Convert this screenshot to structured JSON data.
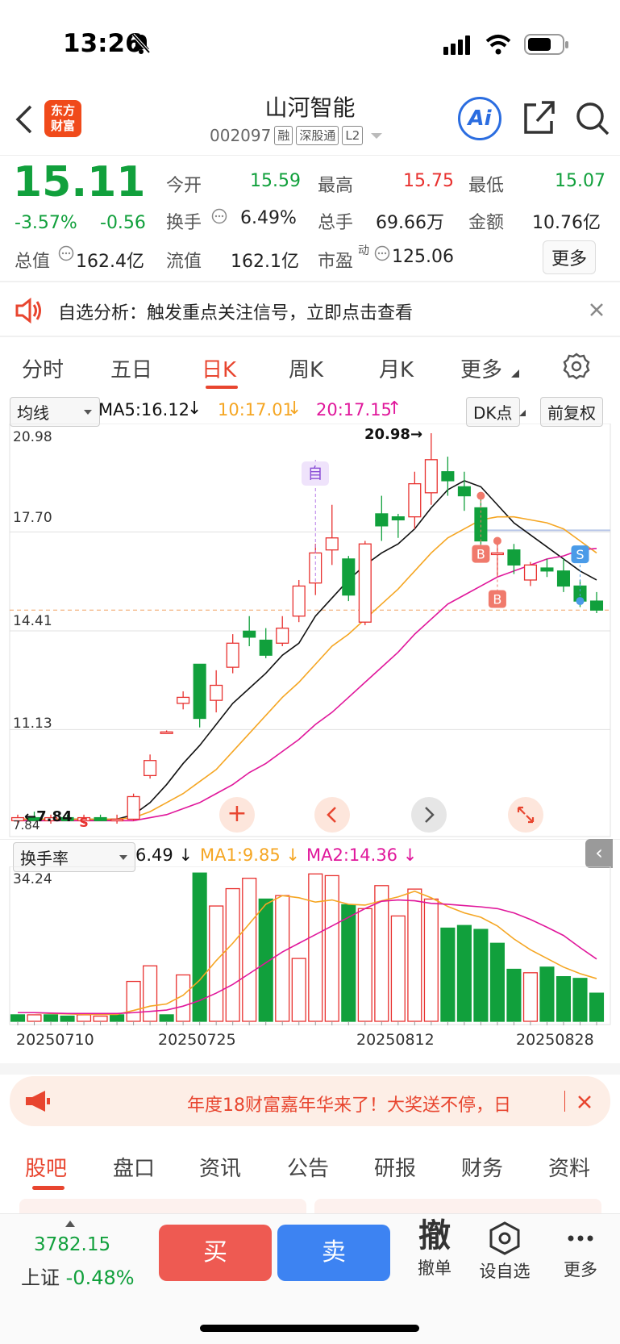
{
  "status_bar": {
    "time": "13:26"
  },
  "header": {
    "logo_text": "东方\n财富",
    "title": "山河智能",
    "code": "002097",
    "tags": [
      "融",
      "深股通",
      "L2"
    ],
    "ai_label": "Ai"
  },
  "quote": {
    "price": "15.11",
    "change_pct": "-3.57%",
    "change": "-0.56",
    "open_label": "今开",
    "open": "15.59",
    "high_label": "最高",
    "high": "15.75",
    "low_label": "最低",
    "low": "15.07",
    "turnover_label": "换手",
    "turnover": "6.49%",
    "volume_label": "总手",
    "volume": "69.66万",
    "amount_label": "金额",
    "amount": "10.76亿",
    "mcap_label": "总值",
    "mcap": "162.4亿",
    "float_label": "流值",
    "float": "162.1亿",
    "pe_label": "市盈",
    "pe_sup": "动",
    "pe": "125.06",
    "more": "更多"
  },
  "notice": {
    "text": "自选分析：触发重点关注信号，立即点击查看"
  },
  "chart_tabs": [
    "分时",
    "五日",
    "日K",
    "周K",
    "月K",
    "更多"
  ],
  "active_tab": "日K",
  "ma_bar": {
    "select": "均线",
    "ma5": "MA5:16.12",
    "ma10": "10:17.01",
    "ma20": "20:17.15",
    "dk": "DK点",
    "fq": "前复权"
  },
  "price_axis": [
    "20.98",
    "17.70",
    "14.41",
    "11.13",
    "7.84"
  ],
  "price_annotations": {
    "high": "20.98",
    "low": "7.84",
    "self_tag": "自"
  },
  "turnover_bar": {
    "select": "换手率",
    "value": "6.49",
    "ma1": "MA1:9.85",
    "ma2": "MA2:14.36",
    "axis_top": "34.24"
  },
  "dates": [
    "20250710",
    "20250725",
    "20250812",
    "20250828"
  ],
  "banner": {
    "text": "年度18财富嘉年华来了！大奖送不停，日"
  },
  "bottom_tabs": [
    "股吧",
    "盘口",
    "资讯",
    "公告",
    "研报",
    "财务",
    "资料"
  ],
  "active_bottom_tab": "股吧",
  "footer": {
    "index_value": "3782.15",
    "index_name": "上证",
    "index_change": "-0.48%",
    "buy": "买",
    "sell": "卖",
    "cancel_big": "撤",
    "cancel": "撤单",
    "watch": "设自选",
    "more": "更多"
  },
  "colors": {
    "up": "#e8312f",
    "down": "#11a03c",
    "ma5": "#111111",
    "ma10": "#f5a623",
    "ma20": "#e0179b",
    "accent": "#e8452f",
    "buy": "#ee5a52",
    "sell": "#3d83f2"
  },
  "chart_data": {
    "type": "candlestick",
    "y_range": [
      7.84,
      20.98
    ],
    "candles": [
      {
        "o": 8.1,
        "h": 8.3,
        "l": 8.0,
        "c": 8.2
      },
      {
        "o": 8.2,
        "h": 8.4,
        "l": 8.1,
        "c": 8.1
      },
      {
        "o": 8.1,
        "h": 8.3,
        "l": 8.0,
        "c": 8.2
      },
      {
        "o": 8.2,
        "h": 8.3,
        "l": 8.1,
        "c": 8.1
      },
      {
        "o": 8.1,
        "h": 8.3,
        "l": 8.0,
        "c": 8.2
      },
      {
        "o": 8.2,
        "h": 8.3,
        "l": 8.1,
        "c": 8.1
      },
      {
        "o": 8.1,
        "h": 8.3,
        "l": 8.0,
        "c": 8.15
      },
      {
        "o": 8.15,
        "h": 9.0,
        "l": 8.1,
        "c": 8.9
      },
      {
        "o": 9.6,
        "h": 10.3,
        "l": 9.5,
        "c": 10.1
      },
      {
        "o": 11.0,
        "h": 11.1,
        "l": 11.0,
        "c": 11.05
      },
      {
        "o": 12.0,
        "h": 12.4,
        "l": 11.8,
        "c": 12.2
      },
      {
        "o": 13.3,
        "h": 13.3,
        "l": 11.2,
        "c": 11.5
      },
      {
        "o": 12.1,
        "h": 13.1,
        "l": 11.7,
        "c": 12.6
      },
      {
        "o": 13.2,
        "h": 14.3,
        "l": 13.0,
        "c": 14.0
      },
      {
        "o": 14.4,
        "h": 14.9,
        "l": 13.9,
        "c": 14.2
      },
      {
        "o": 14.1,
        "h": 14.5,
        "l": 13.5,
        "c": 13.6
      },
      {
        "o": 14.0,
        "h": 14.9,
        "l": 13.9,
        "c": 14.5
      },
      {
        "o": 14.9,
        "h": 16.1,
        "l": 14.7,
        "c": 15.9
      },
      {
        "o": 16.0,
        "h": 17.3,
        "l": 15.6,
        "c": 17.0
      },
      {
        "o": 17.1,
        "h": 18.6,
        "l": 16.6,
        "c": 17.5
      },
      {
        "o": 16.8,
        "h": 16.9,
        "l": 15.4,
        "c": 15.6
      },
      {
        "o": 14.7,
        "h": 17.4,
        "l": 14.6,
        "c": 17.3
      },
      {
        "o": 18.3,
        "h": 18.9,
        "l": 17.4,
        "c": 17.9
      },
      {
        "o": 18.2,
        "h": 18.3,
        "l": 17.5,
        "c": 18.1
      },
      {
        "o": 18.2,
        "h": 19.7,
        "l": 17.8,
        "c": 19.3
      },
      {
        "o": 19.0,
        "h": 20.98,
        "l": 18.6,
        "c": 20.1
      },
      {
        "o": 19.7,
        "h": 20.2,
        "l": 18.9,
        "c": 19.4
      },
      {
        "o": 19.2,
        "h": 19.7,
        "l": 18.4,
        "c": 18.9
      },
      {
        "o": 18.5,
        "h": 18.9,
        "l": 17.1,
        "c": 17.4
      },
      {
        "o": 17.0,
        "h": 17.5,
        "l": 16.2,
        "c": 17.0
      },
      {
        "o": 17.1,
        "h": 17.3,
        "l": 16.3,
        "c": 16.6
      },
      {
        "o": 16.1,
        "h": 16.7,
        "l": 15.9,
        "c": 16.6
      },
      {
        "o": 16.5,
        "h": 16.8,
        "l": 16.2,
        "c": 16.4
      },
      {
        "o": 16.4,
        "h": 16.8,
        "l": 15.7,
        "c": 15.9
      },
      {
        "o": 15.9,
        "h": 16.1,
        "l": 15.2,
        "c": 15.4
      },
      {
        "o": 15.4,
        "h": 15.7,
        "l": 15.0,
        "c": 15.1
      }
    ],
    "ma_lines": [
      {
        "name": "MA5",
        "values": [
          8.15,
          8.15,
          8.15,
          8.15,
          8.15,
          8.14,
          8.15,
          8.3,
          8.7,
          9.3,
          10.0,
          10.6,
          11.3,
          12.0,
          12.5,
          13.0,
          13.6,
          14.0,
          14.9,
          15.5,
          16.1,
          16.6,
          17.0,
          17.3,
          17.8,
          18.5,
          19.1,
          19.4,
          19.2,
          18.6,
          18.0,
          17.6,
          17.2,
          16.8,
          16.4,
          16.1
        ]
      },
      {
        "name": "MA10",
        "values": [
          8.15,
          8.15,
          8.15,
          8.15,
          8.15,
          8.15,
          8.15,
          8.2,
          8.4,
          8.7,
          9.0,
          9.4,
          9.8,
          10.4,
          11.0,
          11.6,
          12.2,
          12.7,
          13.3,
          13.9,
          14.3,
          14.8,
          15.3,
          15.8,
          16.4,
          17.0,
          17.5,
          17.8,
          18.1,
          18.2,
          18.2,
          18.1,
          18.0,
          17.8,
          17.4,
          17.0
        ]
      },
      {
        "name": "MA20",
        "values": [
          8.1,
          8.1,
          8.1,
          8.1,
          8.1,
          8.1,
          8.1,
          8.1,
          8.2,
          8.3,
          8.5,
          8.7,
          9.0,
          9.3,
          9.7,
          10.0,
          10.4,
          10.8,
          11.3,
          11.7,
          12.2,
          12.7,
          13.2,
          13.7,
          14.3,
          14.8,
          15.3,
          15.6,
          15.9,
          16.2,
          16.4,
          16.6,
          16.8,
          16.9,
          17.1,
          17.15
        ]
      }
    ],
    "turnover_series": {
      "y_range": [
        0,
        34.24
      ],
      "values": [
        1.5,
        1.5,
        1.5,
        1.2,
        1.5,
        1.2,
        1.5,
        9.2,
        12.8,
        1.5,
        10.7,
        34.2,
        26.6,
        30.6,
        33.0,
        28.2,
        29.0,
        14.5,
        34.0,
        33.6,
        26.9,
        26.0,
        31.3,
        24.3,
        30.5,
        28.2,
        21.5,
        22.1,
        21.2,
        18.0,
        12.0,
        11.2,
        12.5,
        10.3,
        9.9,
        6.49
      ],
      "up": [
        0,
        1,
        0,
        0,
        1,
        1,
        0,
        1,
        1,
        0,
        1,
        0,
        1,
        1,
        1,
        0,
        1,
        1,
        1,
        1,
        0,
        1,
        1,
        1,
        1,
        1,
        0,
        0,
        0,
        0,
        0,
        1,
        0,
        0,
        0,
        0
      ],
      "ma1": [
        2.0,
        2.0,
        1.8,
        1.7,
        1.6,
        1.6,
        1.6,
        2.5,
        3.5,
        4.0,
        6.0,
        9.5,
        14.0,
        18.0,
        22.5,
        27.0,
        29.0,
        28.5,
        27.5,
        28.0,
        27.0,
        26.8,
        27.8,
        28.7,
        30.0,
        28.5,
        26.5,
        25.0,
        24.0,
        22.0,
        19.0,
        16.5,
        14.5,
        12.5,
        11.0,
        9.85
      ],
      "ma2": [
        2.0,
        2.0,
        1.9,
        1.8,
        1.8,
        1.8,
        1.8,
        2.0,
        2.3,
        2.6,
        3.5,
        4.8,
        6.5,
        8.5,
        11.0,
        13.5,
        16.0,
        18.0,
        20.0,
        22.0,
        24.0,
        26.0,
        27.7,
        28.0,
        27.8,
        27.2,
        27.0,
        26.7,
        26.4,
        26.0,
        25.0,
        23.5,
        21.7,
        19.8,
        17.0,
        14.36
      ]
    }
  }
}
